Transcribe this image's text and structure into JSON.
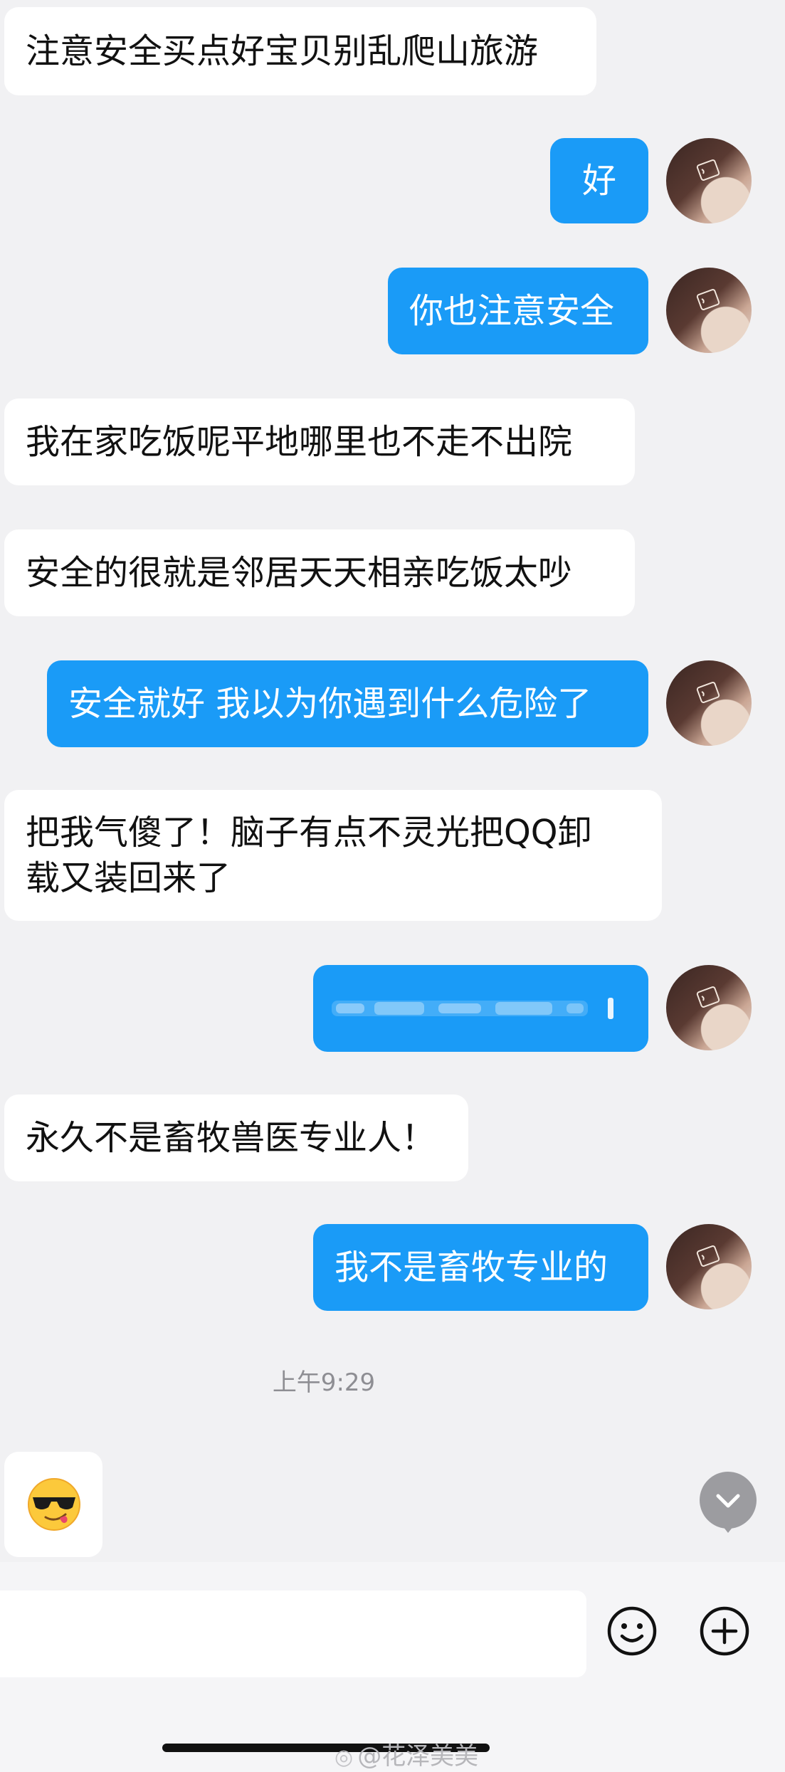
{
  "messages": [
    {
      "side": "in",
      "text": "注意安全买点好宝贝别乱爬山旅游"
    },
    {
      "side": "out",
      "text": "好"
    },
    {
      "side": "out",
      "text": "你也注意安全"
    },
    {
      "side": "in",
      "text": "我在家吃饭呢平地哪里也不走不出院"
    },
    {
      "side": "in",
      "text": "安全的很就是邻居天天相亲吃饭太吵"
    },
    {
      "side": "out",
      "text": "安全就好 我以为你遇到什么危险了"
    },
    {
      "side": "in",
      "text": "把我气傻了！脑子有点不灵光把QQ卸载又装回来了",
      "line1": "把我气傻了！脑子有点不灵光把QQ卸",
      "line2": "载又装回来了"
    },
    {
      "side": "out",
      "text": "",
      "obscured": true
    },
    {
      "side": "in",
      "text": "永久不是畜牧兽医专业人！"
    },
    {
      "side": "out",
      "text": "我不是畜牧专业的"
    }
  ],
  "timestamp": "上午9:29",
  "emoji_message": {
    "icon": "sunglasses-tongue-emoji-icon"
  },
  "input": {
    "value": "",
    "placeholder": ""
  },
  "icons": {
    "scroll_down": "chevron-down-icon",
    "emoji_button": "smiley-face-icon",
    "add_button": "plus-circle-icon"
  },
  "watermark": {
    "prefix": "@",
    "name": "花泽美美"
  },
  "colors": {
    "outgoing_bubble": "#1a9bf7",
    "incoming_bubble": "#ffffff",
    "background": "#f1f1f3"
  }
}
